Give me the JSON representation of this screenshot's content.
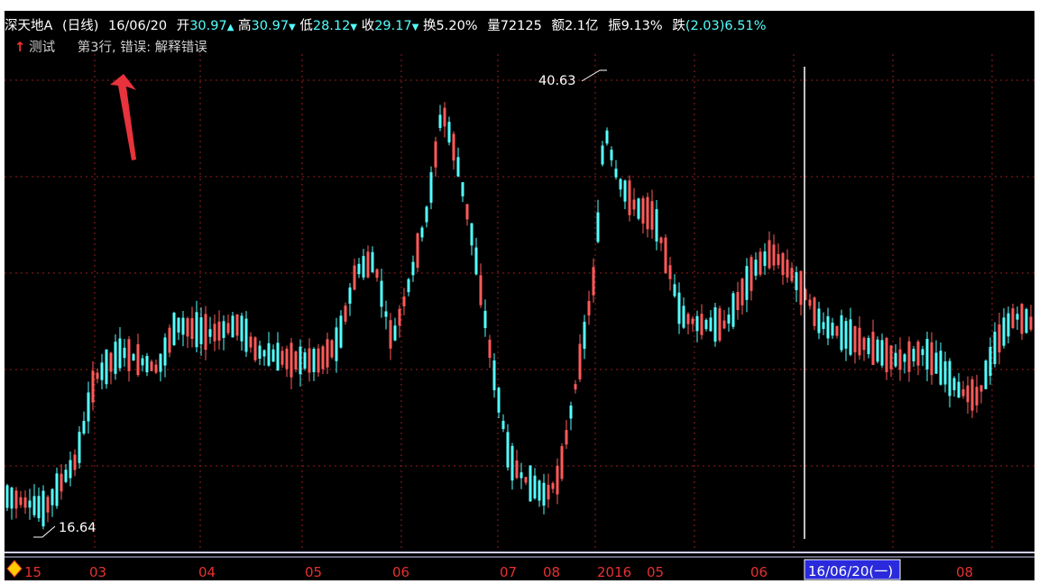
{
  "header": {
    "stock_name": "深天地A",
    "period": "(日线)",
    "date": "16/06/20",
    "open_label": "开",
    "open_value": "30.97",
    "high_label": "高",
    "high_value": "30.97",
    "low_label": "低",
    "low_value": "28.12",
    "close_label": "收",
    "close_value": "29.17",
    "turnover_label": "换",
    "turnover_value": "5.20%",
    "volume_label": "量",
    "volume_value": "72125",
    "amount_label": "额",
    "amount_value": "2.1亿",
    "amplitude_label": "振",
    "amplitude_value": "9.13%",
    "change_label": "跌",
    "change_value": "(2.03)6.51%"
  },
  "note": {
    "test_label": "测试",
    "message": "第3行, 错误: 解释错误"
  },
  "annotations": {
    "max_label": "40.63",
    "min_label": "16.64"
  },
  "axis": {
    "ticks": [
      "15",
      "03",
      "04",
      "05",
      "06",
      "07",
      "08",
      "2016",
      "05",
      "06",
      "08"
    ],
    "selected_date": "16/06/20(一)"
  },
  "colors": {
    "up": "#ff5a5a",
    "down": "#54ffff",
    "grid": "#9b1b1b",
    "axis": "#e53030",
    "annotation_arrow": "#e8323c"
  },
  "chart_data": {
    "type": "candlestick",
    "title": "深天地A (日线)",
    "ylim": [
      16.64,
      40.63
    ],
    "max": {
      "value": 40.63
    },
    "min": {
      "value": 16.64
    },
    "selected_date": "16/06/20",
    "selected_ohlc": {
      "open": 30.97,
      "high": 30.97,
      "low": 28.12,
      "close": 29.17
    },
    "x_ticks": [
      "15",
      "03",
      "04",
      "05",
      "06",
      "07",
      "08",
      "2016",
      "05",
      "06",
      "08"
    ],
    "grid": true
  }
}
